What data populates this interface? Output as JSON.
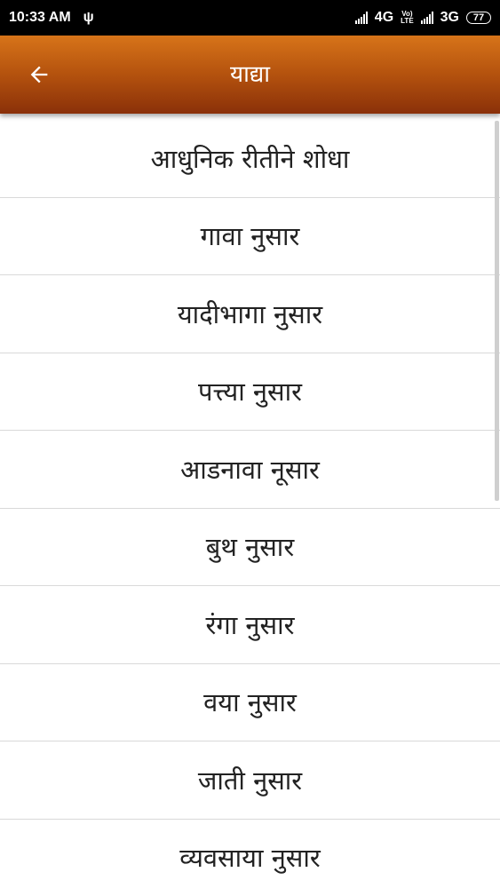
{
  "status_bar": {
    "time": "10:33 AM",
    "network1": "4G",
    "volte_top": "Vo)",
    "volte_bottom": "LTE",
    "network2": "3G",
    "battery": "77"
  },
  "app_bar": {
    "title": "याद्या",
    "back_icon": "arrow-left-icon"
  },
  "menu": {
    "items": [
      {
        "label": "आधुनिक रीतीने शोधा"
      },
      {
        "label": "गावा नुसार"
      },
      {
        "label": "यादीभागा नुसार"
      },
      {
        "label": "पत्त्या नुसार"
      },
      {
        "label": "आडनावा नूसार"
      },
      {
        "label": "बुथ नुसार"
      },
      {
        "label": "रंगा नुसार"
      },
      {
        "label": "वया नुसार"
      },
      {
        "label": "जाती नुसार"
      },
      {
        "label": "व्यवसाया नुसार"
      }
    ]
  },
  "colors": {
    "app_bar_top": "#d77419",
    "app_bar_bottom": "#8a3009",
    "divider": "#d9d9d9"
  }
}
